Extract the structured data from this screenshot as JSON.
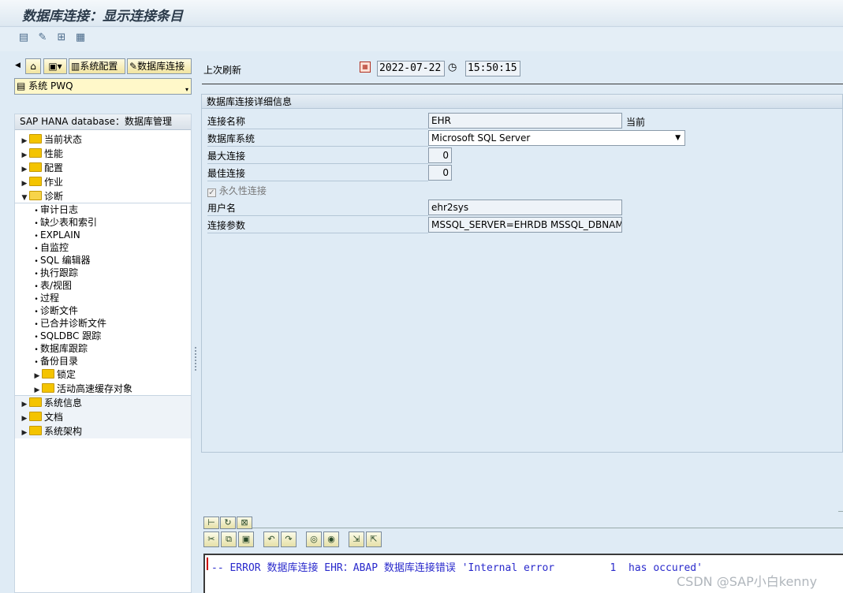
{
  "window": {
    "title": "数据库连接：显示连接条目"
  },
  "app_toolbar": {
    "icons": [
      "table-icon",
      "glasses-icon",
      "transport-icon",
      "layout-icon"
    ]
  },
  "left_pane": {
    "nav_buttons": {
      "system_config_label": "系统配置",
      "db_connection_label": "数据库连接"
    },
    "system_field_value": "系统 PWQ",
    "tree_header": "SAP HANA database：数据库管理",
    "tree": {
      "current_status": "当前状态",
      "performance": "性能",
      "configuration": "配置",
      "jobs": "作业",
      "diagnostics": "诊断",
      "diagnostics_children": [
        "审计日志",
        "缺少表和索引",
        "EXPLAIN",
        "自监控",
        "SQL 编辑器",
        "执行跟踪",
        "表/视图",
        "过程",
        "诊断文件",
        "已合并诊断文件",
        "SQLDBC 跟踪",
        "数据库跟踪",
        "备份目录"
      ],
      "locks": "锁定",
      "active_cache_objects": "活动高速缓存对象",
      "system_info": "系统信息",
      "documents": "文档",
      "system_landscape": "系统架构"
    }
  },
  "refresh": {
    "label": "上次刷新",
    "date": "2022-07-22",
    "time": "15:50:15"
  },
  "details": {
    "group_title": "数据库连接详细信息",
    "connection_name_label": "连接名称",
    "connection_name_value": "EHR",
    "current_label": "当前",
    "db_system_label": "数据库系统",
    "db_system_value": "Microsoft SQL Server",
    "max_conn_label": "最大连接",
    "max_conn_value": "0",
    "opt_conn_label": "最佳连接",
    "opt_conn_value": "0",
    "permanent_label": "永久性连接",
    "permanent_checked": true,
    "user_label": "用户名",
    "user_value": "ehr2sys",
    "params_label": "连接参数",
    "params_value": "MSSQL_SERVER=EHRDB MSSQL_DBNAME…"
  },
  "log": {
    "message": "-- ERROR 数据库连接 EHR：ABAP 数据库连接错误 'Internal error         1  has occured'"
  },
  "watermark": "CSDN @SAP小白kenny",
  "colors": {
    "background": "#dfebf5",
    "field_yellow": "#fff8c9",
    "log_text": "#2a2acc"
  }
}
